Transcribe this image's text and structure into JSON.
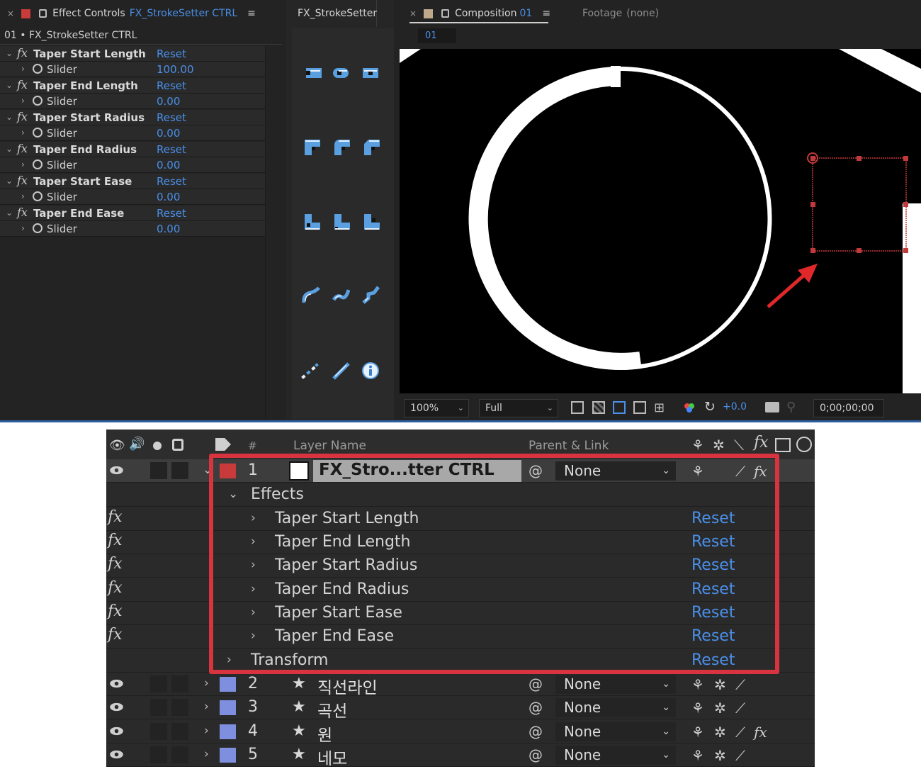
{
  "effect_controls": {
    "close": "×",
    "tab_label": "Effect Controls",
    "tab_target": "FX_StrokeSetter CTRL",
    "menu": "≡",
    "subtitle": "01 • FX_StrokeSetter CTRL",
    "effects": [
      {
        "name": "Taper Start Length",
        "reset": "Reset",
        "param": "Slider",
        "value": "100.00"
      },
      {
        "name": "Taper End Length",
        "reset": "Reset",
        "param": "Slider",
        "value": "0.00"
      },
      {
        "name": "Taper Start Radius",
        "reset": "Reset",
        "param": "Slider",
        "value": "0.00"
      },
      {
        "name": "Taper End Radius",
        "reset": "Reset",
        "param": "Slider",
        "value": "0.00"
      },
      {
        "name": "Taper Start Ease",
        "reset": "Reset",
        "param": "Slider",
        "value": "0.00"
      },
      {
        "name": "Taper End Ease",
        "reset": "Reset",
        "param": "Slider",
        "value": "0.00"
      }
    ]
  },
  "fx_panel": {
    "title": "FX_StrokeSetter"
  },
  "composition": {
    "close": "×",
    "tab_label": "Composition",
    "tab_name": "01",
    "menu": "≡",
    "footage_label": "Footage",
    "footage_value": "(none)",
    "subtab": "01",
    "zoom": "100%",
    "resolution": "Full",
    "exposure": "+0.0",
    "timecode": "0;00;00;00"
  },
  "timeline": {
    "header": {
      "layer_name": "Layer Name",
      "parent_link": "Parent & Link",
      "hash": "#"
    },
    "layer1": {
      "num": "1",
      "name": "FX_Stro...tter CTRL",
      "parent": "None",
      "color": "#c93a3a"
    },
    "effects_label": "Effects",
    "effects": [
      {
        "name": "Taper Start Length",
        "reset": "Reset"
      },
      {
        "name": "Taper End Length",
        "reset": "Reset"
      },
      {
        "name": "Taper Start Radius",
        "reset": "Reset"
      },
      {
        "name": "Taper End Radius",
        "reset": "Reset"
      },
      {
        "name": "Taper Start Ease",
        "reset": "Reset"
      },
      {
        "name": "Taper End Ease",
        "reset": "Reset"
      }
    ],
    "transform": {
      "name": "Transform",
      "reset": "Reset"
    },
    "layers": [
      {
        "num": "2",
        "name": "직선라인",
        "parent": "None",
        "color": "#7f8fe0"
      },
      {
        "num": "3",
        "name": "곡선",
        "parent": "None",
        "color": "#7f8fe0"
      },
      {
        "num": "4",
        "name": "원",
        "parent": "None",
        "color": "#7f8fe0"
      },
      {
        "num": "5",
        "name": "네모",
        "parent": "None",
        "color": "#7f8fe0"
      }
    ]
  }
}
